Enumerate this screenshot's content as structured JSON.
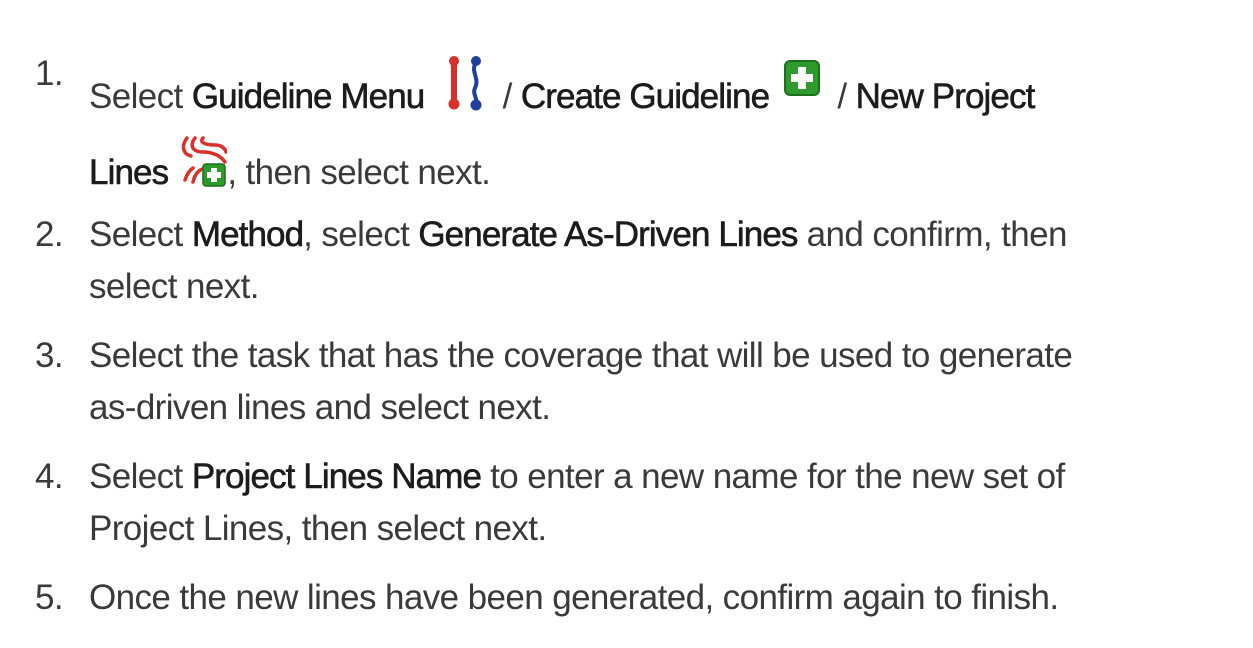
{
  "steps": [
    {
      "num": "1.",
      "t1": "Select ",
      "b1": "Guideline Menu",
      "t2": " / ",
      "b2": "Create Guideline",
      "t3": " / ",
      "b3": "New Project",
      "b4": "Lines",
      "t4": ", then select next."
    },
    {
      "num": "2.",
      "t1": "Select ",
      "b1": "Method",
      "t2": ", select ",
      "b2": "Generate As-Driven Lines",
      "t3": " and confirm, then",
      "t4": "select next."
    },
    {
      "num": "3.",
      "t1": "Select the task that has the coverage that will be used to generate",
      "t2": "as-driven lines and select next."
    },
    {
      "num": "4.",
      "t1": "Select ",
      "b1": "Project Lines Name",
      "t2": " to enter a new name for the new set of",
      "t3": "Project Lines, then select next."
    },
    {
      "num": "5.",
      "t1": "Once the new lines have been generated, confirm again to finish."
    }
  ],
  "icons": {
    "guideline_menu": "guideline-menu-icon",
    "create_guideline": "create-guideline-icon",
    "new_project_lines": "new-project-lines-icon"
  },
  "colors": {
    "text": "#3a3a3a",
    "bold_text": "#1c1c1c",
    "red": "#d9302a",
    "blue": "#1f3f9e",
    "green": "#2f9a2c"
  }
}
